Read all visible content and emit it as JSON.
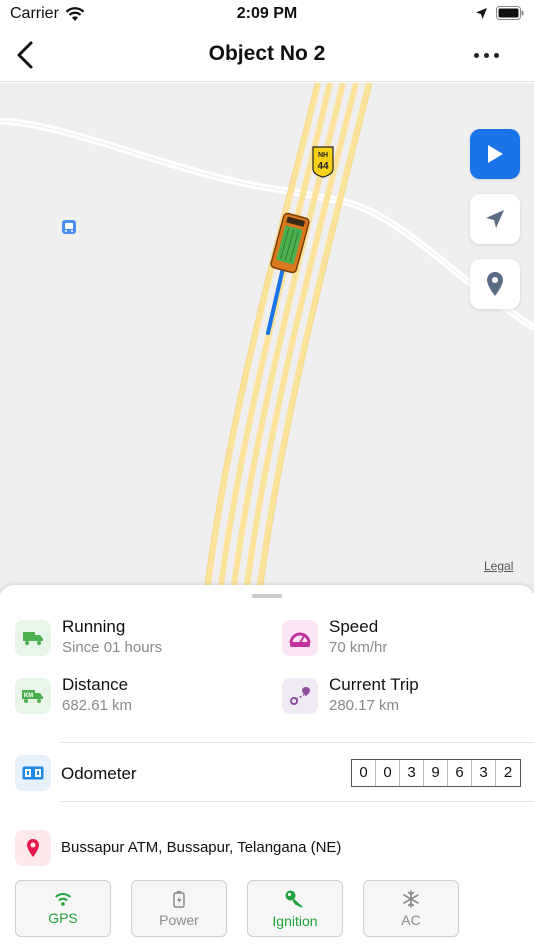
{
  "status_bar": {
    "carrier": "Carrier",
    "time": "2:09 PM"
  },
  "nav": {
    "title": "Object No 2"
  },
  "map": {
    "road_shield": "NH\n44",
    "road_shield_top": "NH",
    "road_shield_num": "44",
    "legal": "Legal"
  },
  "stats": {
    "status": {
      "label": "Running",
      "value": "Since 01 hours"
    },
    "speed": {
      "label": "Speed",
      "value": "70 km/hr"
    },
    "distance": {
      "label": "Distance",
      "value": "682.61 km"
    },
    "current_trip": {
      "label": "Current Trip",
      "value": "280.17 km"
    }
  },
  "odometer": {
    "label": "Odometer",
    "digits": [
      "0",
      "0",
      "3",
      "9",
      "6",
      "3",
      "2"
    ]
  },
  "location": {
    "address": "Bussapur ATM, Bussapur, Telangana (NE)"
  },
  "sensors": [
    {
      "label": "GPS",
      "state": "on",
      "icon": "wifi-icon"
    },
    {
      "label": "Power",
      "state": "off",
      "icon": "battery-icon"
    },
    {
      "label": "Ignition",
      "state": "on",
      "icon": "key-icon"
    },
    {
      "label": "AC",
      "state": "off",
      "icon": "snowflake-icon"
    }
  ],
  "colors": {
    "accent": "#1a73e8",
    "on": "#1fa33a",
    "off": "#8a8a8a",
    "road": "#fbe29a",
    "running": "#4caf50",
    "speed": "#c0339b",
    "pin": "#e5194b"
  }
}
